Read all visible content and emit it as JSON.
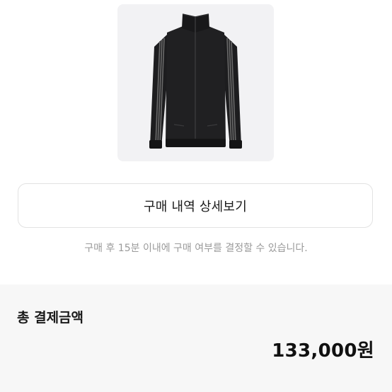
{
  "product": {
    "image_alt": "black track jacket",
    "icon": "track-jacket-image"
  },
  "actions": {
    "view_details_label": "구매 내역 상세보기"
  },
  "notice": {
    "text": "구매 후 15분 이내에 구매 여부를 결정할 수 있습니다."
  },
  "summary": {
    "total_label": "총 결제금액",
    "total_amount": "133,000원"
  }
}
